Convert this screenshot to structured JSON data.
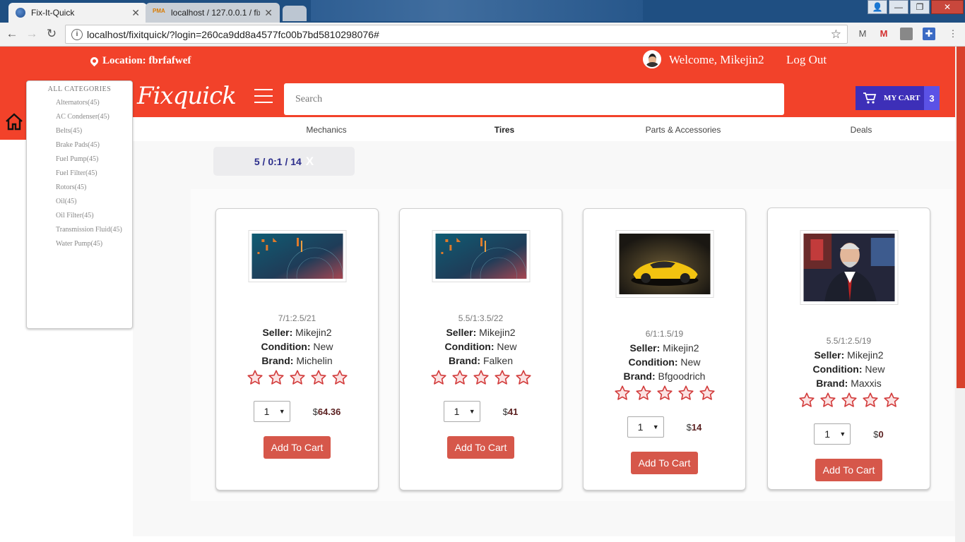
{
  "browser": {
    "tabs": [
      {
        "title": "Fix-It-Quick",
        "active": true
      },
      {
        "title": "localhost / 127.0.0.1 / fix",
        "active": false
      }
    ],
    "url": "localhost/fixitquick/?login=260ca9dd8a4577fc00b7bd5810298076#",
    "pma_label": "PMA"
  },
  "header": {
    "location": "Location: fbrfafwef",
    "welcome": "Welcome, Mikejin2",
    "logout": "Log Out",
    "logo": "Fixquick",
    "search_placeholder": "Search",
    "cart_label": "MY CART",
    "cart_count": "3",
    "brand_color": "#f2422a",
    "cart_color": "#3d2fb8"
  },
  "categories": {
    "title": "ALL CATEGORIES",
    "items": [
      "Alternators(45)",
      "AC Condenser(45)",
      "Belts(45)",
      "Brake Pads(45)",
      "Fuel Pump(45)",
      "Fuel Filter(45)",
      "Rotors(45)",
      "Oil(45)",
      "Oil Filter(45)",
      "Transmission Fluid(45)",
      "Water Pump(45)"
    ]
  },
  "nav": {
    "items": [
      "Mechanics",
      "Tires",
      "Parts & Accessories",
      "Deals"
    ],
    "active": "Tires"
  },
  "filter": {
    "text": "5 / 0:1 / 14",
    "close": "X"
  },
  "products": [
    {
      "size": "7/1:2.5/21",
      "seller_label": "Seller:",
      "seller": "Mikejin2",
      "condition_label": "Condition:",
      "condition": "New",
      "brand_label": "Brand:",
      "brand": "Michelin",
      "qty": "1",
      "currency": "$",
      "price": "64.36",
      "button": "Add To Cart",
      "image": "abstract-blue"
    },
    {
      "size": "5.5/1:3.5/22",
      "seller_label": "Seller:",
      "seller": "Mikejin2",
      "condition_label": "Condition:",
      "condition": "New",
      "brand_label": "Brand:",
      "brand": "Falken",
      "qty": "1",
      "currency": "$",
      "price": "41",
      "button": "Add To Cart",
      "image": "abstract-blue"
    },
    {
      "size": "6/1:1.5/19",
      "seller_label": "Seller:",
      "seller": "Mikejin2",
      "condition_label": "Condition:",
      "condition": "New",
      "brand_label": "Brand:",
      "brand": "Bfgoodrich",
      "qty": "1",
      "currency": "$",
      "price": "14",
      "button": "Add To Cart",
      "image": "yellow-car"
    },
    {
      "size": "5.5/1:2.5/19",
      "seller_label": "Seller:",
      "seller": "Mikejin2",
      "condition_label": "Condition:",
      "condition": "New",
      "brand_label": "Brand:",
      "brand": "Maxxis",
      "qty": "1",
      "currency": "$",
      "price": "0",
      "button": "Add To Cart",
      "image": "man-speaking"
    }
  ]
}
